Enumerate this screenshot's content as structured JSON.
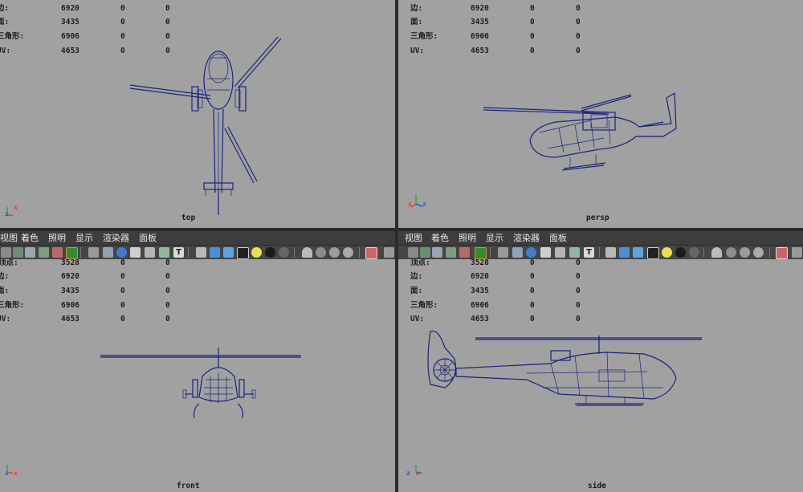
{
  "stats": {
    "labels": {
      "vertices": "顶点:",
      "edges": "边:",
      "faces": "面:",
      "triangles": "三角形:",
      "uvs": "UV:"
    },
    "values": {
      "vertices": [
        "3528",
        "0",
        "0"
      ],
      "edges": [
        "6920",
        "0",
        "0"
      ],
      "faces": [
        "3435",
        "0",
        "0"
      ],
      "triangles": [
        "6906",
        "0",
        "0"
      ],
      "uvs": [
        "4653",
        "0",
        "0"
      ]
    }
  },
  "menu": {
    "view_left": "视图",
    "view": "视图",
    "shading": "着色",
    "lighting": "照明",
    "show": "显示",
    "renderer": "渲染器",
    "panels": "面板"
  },
  "cameras": {
    "top": "top",
    "persp": "persp",
    "front": "front",
    "side": "side"
  },
  "axis": {
    "top": [
      "z",
      "x"
    ],
    "persp": [
      "x",
      "z"
    ],
    "front": [
      "z",
      "x"
    ],
    "side": [
      "z",
      "x"
    ]
  },
  "colors": {
    "viewport_bg": "#a1a1a1",
    "wireframe": "#1a237e",
    "stat_label": "#1c1c1c",
    "axis_x": "#e53935",
    "axis_y": "#43a047",
    "axis_z": "#1e5bd8"
  }
}
